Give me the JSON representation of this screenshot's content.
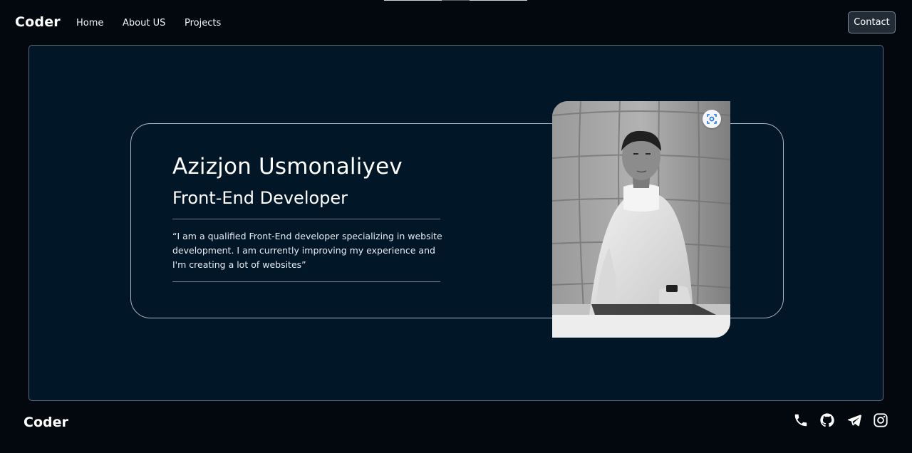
{
  "navbar": {
    "brand": "Coder",
    "links": [
      "Home",
      "About US",
      "Projects"
    ],
    "contact_label": "Contact"
  },
  "hero": {
    "name": "Azizjon Usmonaliyev",
    "role": "Front-End Developer",
    "quote": "“I am a qualified Front-End developer specializing in website development. I am currently improving my experience and I'm creating a lot of websites”",
    "photo_lens_icon": "lens-search-icon"
  },
  "footer": {
    "brand": "Coder",
    "socials": [
      "phone-icon",
      "github-icon",
      "telegram-icon",
      "instagram-icon"
    ]
  },
  "colors": {
    "page_background": "#03070e",
    "hero_background": "#011627",
    "card_border": "#a9b7c6",
    "text": "#ffffff"
  }
}
